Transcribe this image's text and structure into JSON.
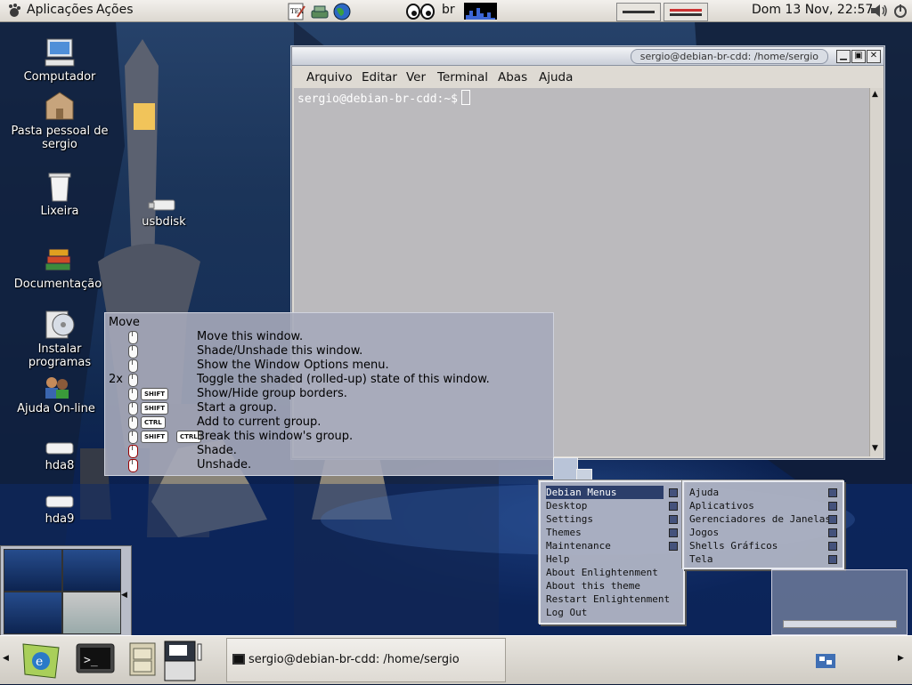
{
  "top_panel": {
    "menus": [
      "Aplicações",
      "Ações"
    ],
    "keyboard_layout": "br",
    "clock": "Dom 13 Nov, 22:57",
    "launchers": [
      "text-editor-icon",
      "network-icon",
      "browser-globe-icon"
    ]
  },
  "desktop_icons": [
    {
      "label": "Computador",
      "icon": "computer-icon"
    },
    {
      "label": "Pasta pessoal de sergio",
      "icon": "home-folder-icon"
    },
    {
      "label": "Lixeira",
      "icon": "trash-icon"
    },
    {
      "label": "usbdisk",
      "icon": "usb-disk-icon"
    },
    {
      "label": "Documentação",
      "icon": "books-icon"
    },
    {
      "label": "Instalar programas",
      "icon": "install-cd-icon"
    },
    {
      "label": "Ajuda On-line",
      "icon": "help-people-icon"
    },
    {
      "label": "hda8",
      "icon": "hard-drive-icon"
    },
    {
      "label": "hda9",
      "icon": "hard-drive-icon"
    }
  ],
  "terminal": {
    "title": "sergio@debian-br-cdd: /home/sergio",
    "menu": [
      "Arquivo",
      "Editar",
      "Ver",
      "Terminal",
      "Abas",
      "Ajuda"
    ],
    "prompt": "sergio@debian-br-cdd:~$",
    "buttons": {
      "minimize": "▁",
      "maximize": "▣",
      "close": "✕"
    }
  },
  "tooltip": {
    "title": "Move",
    "rows": [
      {
        "prefix": "",
        "keys": [],
        "desc": "Move this window."
      },
      {
        "prefix": "",
        "keys": [],
        "desc": "Shade/Unshade this window."
      },
      {
        "prefix": "",
        "keys": [],
        "desc": "Show the Window Options menu."
      },
      {
        "prefix": "2x",
        "keys": [],
        "desc": "Toggle the shaded (rolled-up) state of this window."
      },
      {
        "prefix": "",
        "keys": [
          "SHIFT"
        ],
        "desc": "Show/Hide group borders."
      },
      {
        "prefix": "",
        "keys": [
          "SHIFT"
        ],
        "desc": "Start a group."
      },
      {
        "prefix": "",
        "keys": [
          "CTRL"
        ],
        "desc": "Add to current group."
      },
      {
        "prefix": "",
        "keys": [
          "SHIFT",
          "CTRL"
        ],
        "desc": "Break this window's group."
      },
      {
        "prefix": "",
        "keys": [],
        "desc": "Shade."
      },
      {
        "prefix": "",
        "keys": [],
        "desc": "Unshade."
      }
    ]
  },
  "emenu_main": {
    "items": [
      {
        "label": "Debian Menus",
        "submenu": true,
        "selected": true
      },
      {
        "label": "Desktop",
        "submenu": true
      },
      {
        "label": "Settings",
        "submenu": true
      },
      {
        "label": "Themes",
        "submenu": true
      },
      {
        "label": "Maintenance",
        "submenu": true
      },
      {
        "label": "Help",
        "submenu": false
      },
      {
        "label": "About Enlightenment",
        "submenu": false
      },
      {
        "label": "About this theme",
        "submenu": false
      },
      {
        "label": "Restart Enlightenment",
        "submenu": false
      },
      {
        "label": "Log Out",
        "submenu": false
      }
    ]
  },
  "emenu_sub": {
    "items": [
      {
        "label": "Ajuda",
        "submenu": true
      },
      {
        "label": "Aplicativos",
        "submenu": true
      },
      {
        "label": "Gerenciadores de Janelas",
        "submenu": true
      },
      {
        "label": "Jogos",
        "submenu": true
      },
      {
        "label": "Shells Gráficos",
        "submenu": true
      },
      {
        "label": "Tela",
        "submenu": true
      }
    ]
  },
  "taskbar": {
    "task_label": "sergio@debian-br-cdd: /home/sergio"
  },
  "colors": {
    "menu_selection": "#2c3e6a",
    "desktop_sky": "#26426a"
  }
}
